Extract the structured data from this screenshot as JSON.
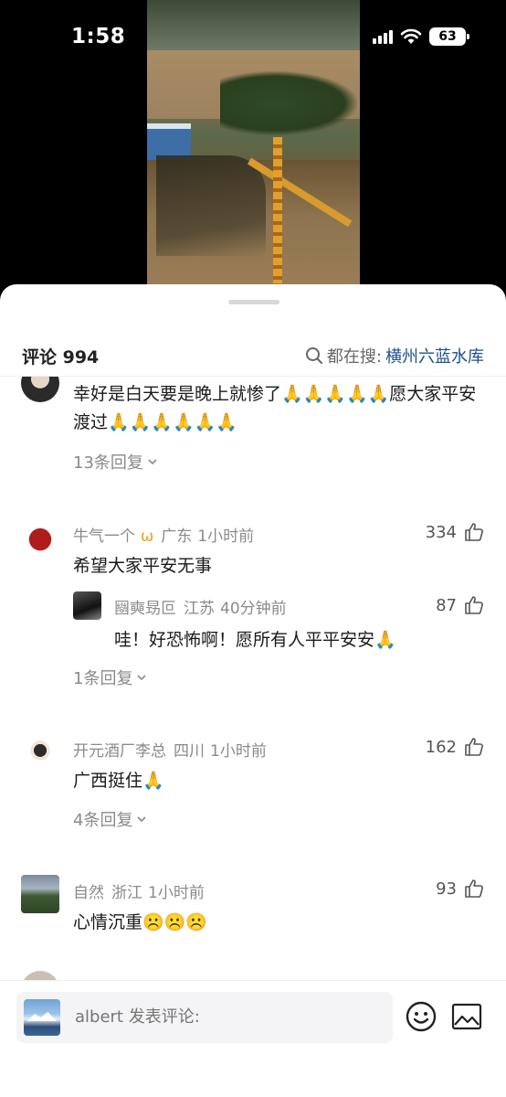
{
  "status_bar": {
    "time": "1:58",
    "battery": "63"
  },
  "header": {
    "comment_count_label": "评论 994",
    "search_prefix": "都在搜:",
    "search_term": "横州六蓝水库"
  },
  "comments": [
    {
      "text": "幸好是白天要是晚上就惨了🙏🙏🙏🙏🙏愿大家平安渡过🙏🙏🙏🙏🙏🙏",
      "replies_label": "13条回复"
    },
    {
      "name": "牛气一个",
      "location": "广东",
      "time": "1小时前",
      "likes": "334",
      "text": "希望大家平安无事",
      "reply": {
        "name": "圝奭昮叵",
        "location": "江苏",
        "time": "40分钟前",
        "likes": "87",
        "text": "哇！好恐怖啊！愿所有人平平安安🙏"
      },
      "replies_label": "1条回复"
    },
    {
      "name": "开元酒厂李总",
      "location": "四川",
      "time": "1小时前",
      "likes": "162",
      "text": "广西挺住🙏",
      "replies_label": "4条回复"
    },
    {
      "name": "自然",
      "location": "浙江",
      "time": "1小时前",
      "likes": "93",
      "text": "心情沉重☹️☹️☹️"
    }
  ],
  "composer": {
    "placeholder": "albert 发表评论:"
  },
  "icons": {
    "like": "thumbs-up-icon",
    "emoji": "smiley-icon",
    "image": "image-icon",
    "search": "search-icon"
  },
  "colors": {
    "link_blue": "#1d4f8c",
    "meta_gray": "#8a8a8a"
  }
}
